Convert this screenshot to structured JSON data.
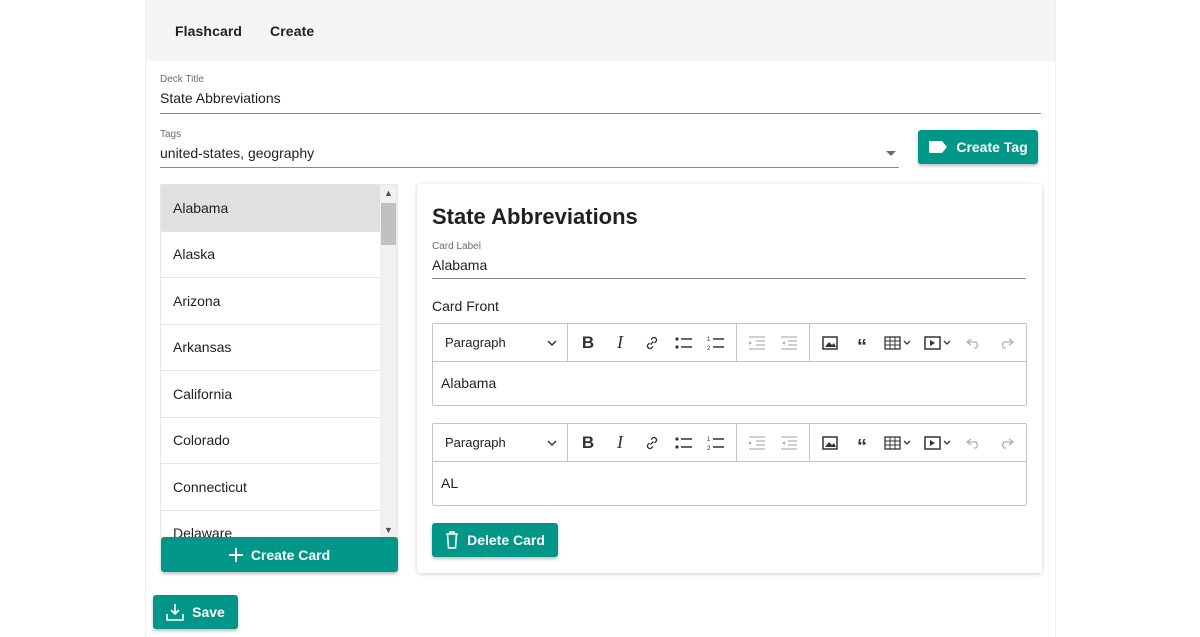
{
  "nav": {
    "items": [
      "Flashcard",
      "Create"
    ]
  },
  "deck": {
    "title_label": "Deck Title",
    "title_value": "State Abbreviations"
  },
  "tags": {
    "label": "Tags",
    "value": "united-states, geography",
    "create_label": "Create Tag"
  },
  "cards": {
    "items": [
      "Alabama",
      "Alaska",
      "Arizona",
      "Arkansas",
      "California",
      "Colorado",
      "Connecticut",
      "Delaware"
    ],
    "selected": "Alabama",
    "create_label": "Create Card"
  },
  "editor": {
    "heading": "State Abbreviations",
    "card_label_label": "Card Label",
    "card_label_value": "Alabama",
    "card_front_label": "Card Front",
    "front_format": "Paragraph",
    "front_content": "Alabama",
    "back_format": "Paragraph",
    "back_content": "AL",
    "delete_label": "Delete Card"
  },
  "save_label": "Save",
  "colors": {
    "accent": "#009688",
    "topbar": "#f5f5f5",
    "selected_row": "#e0e0e0"
  },
  "icons": [
    "tag-icon",
    "plus-icon",
    "trash-icon",
    "download-icon",
    "bold-icon",
    "italic-icon",
    "link-icon",
    "bulleted-list-icon",
    "numbered-list-icon",
    "indent-icon",
    "outdent-icon",
    "image-icon",
    "quote-icon",
    "table-icon",
    "media-icon",
    "undo-icon",
    "redo-icon",
    "chevron-down-icon"
  ]
}
